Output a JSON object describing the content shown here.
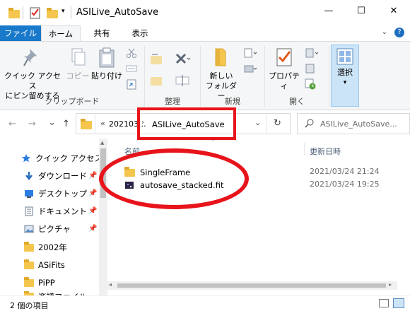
{
  "window": {
    "title": "ASILive_AutoSave",
    "controls": [
      "—",
      "☐",
      "✕"
    ]
  },
  "ribbon_tabs": {
    "file": "ファイル",
    "home": "ホーム",
    "share": "共有",
    "view": "表示",
    "help": "?"
  },
  "ribbon": {
    "clipboard": {
      "pin_label_1": "クイック アクセス",
      "pin_label_2": "にピン留めする",
      "copy_label": "コピー",
      "paste_label": "貼り付け",
      "group_label": "クリップボード"
    },
    "organize": {
      "group_label": "整理"
    },
    "new": {
      "new_folder_label_1": "新しい",
      "new_folder_label_2": "フォルダー",
      "group_label": "新規"
    },
    "open": {
      "properties_label": "プロパティ",
      "group_label": "開く"
    },
    "select": {
      "select_label": "選択"
    }
  },
  "navigation": {
    "back": "←",
    "forward": "→",
    "recent": "⌄",
    "up": "↑",
    "breadcrumb_overflow": "«",
    "breadcrumb_parent": "202103...",
    "breadcrumb_current": "ASILive_AutoSave",
    "refresh": "↻",
    "search_placeholder": "ASILive_AutoSave..."
  },
  "nav_pane": {
    "items": [
      {
        "label": "クイック アクセス",
        "icon": "star-icon"
      },
      {
        "label": "ダウンロード",
        "icon": "download-icon",
        "pinned": true
      },
      {
        "label": "デスクトップ",
        "icon": "desktop-icon",
        "pinned": true
      },
      {
        "label": "ドキュメント",
        "icon": "document-icon",
        "pinned": true
      },
      {
        "label": "ピクチャ",
        "icon": "pictures-icon",
        "pinned": true
      },
      {
        "label": "2002年",
        "icon": "folder-icon"
      },
      {
        "label": "ASiFits",
        "icon": "folder-icon"
      },
      {
        "label": "PiPP",
        "icon": "folder-icon"
      },
      {
        "label": "楽譜ファイル",
        "icon": "folder-icon"
      }
    ]
  },
  "file_list": {
    "columns": {
      "name": "名前",
      "modified": "更新日時"
    },
    "rows": [
      {
        "name": "SingleFrame",
        "modified": "2021/03/24 21:24",
        "icon": "folder-icon"
      },
      {
        "name": "autosave_stacked.fit",
        "modified": "2021/03/24 19:25",
        "icon": "fit-file-icon"
      }
    ]
  },
  "status_bar": {
    "item_count": "2 個の項目"
  },
  "colors": {
    "accent": "#1979ca",
    "annotation": "#e8141b",
    "folder": "#f4c64e"
  }
}
